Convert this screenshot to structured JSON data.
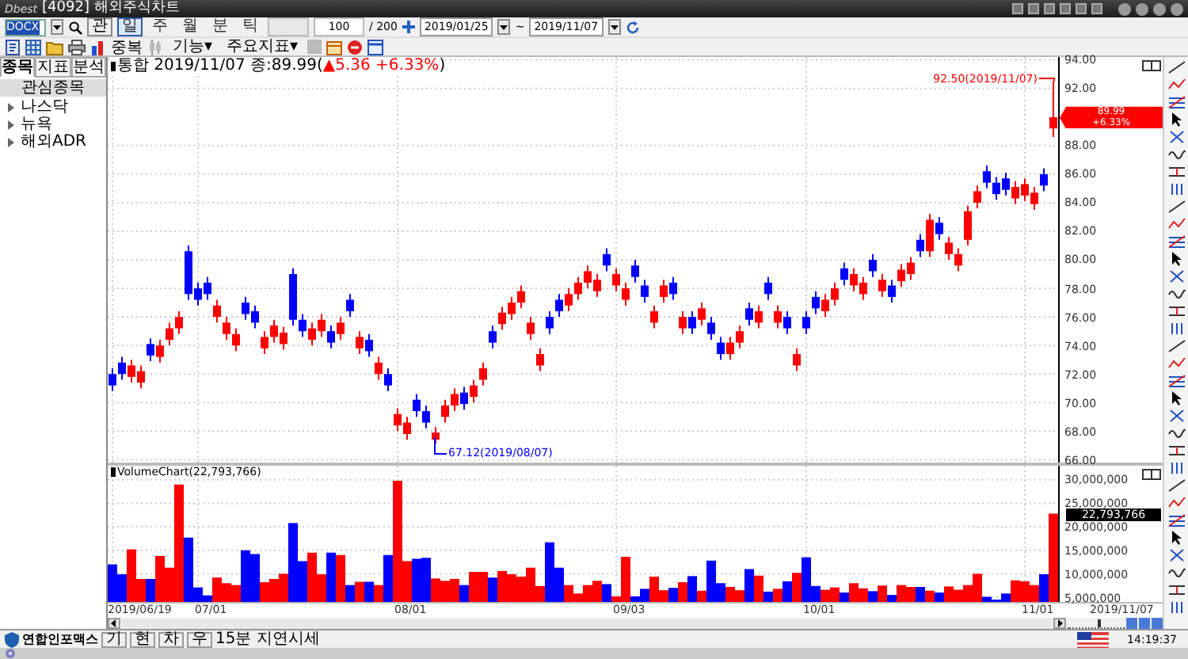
{
  "window": {
    "logo": "Dbest",
    "title": "[4092] 해외주식차트"
  },
  "toolbar": {
    "symbol": "DOCX",
    "lookup_label": "관",
    "periods": [
      {
        "label": "일",
        "selected": true
      },
      {
        "label": "주",
        "selected": false
      },
      {
        "label": "월",
        "selected": false
      },
      {
        "label": "분",
        "selected": false
      },
      {
        "label": "틱",
        "selected": false
      }
    ],
    "count": "100",
    "total": "/ 200",
    "start_date": "2019/01/25",
    "separator": "~",
    "end_date": "2019/11/07"
  },
  "toolbar2": {
    "overlap_label": "중복",
    "menus": [
      "기능▾",
      "주요지표▾"
    ]
  },
  "sidebar": {
    "tabs": [
      {
        "label": "종목",
        "selected": true
      },
      {
        "label": "지표",
        "selected": false
      },
      {
        "label": "분석",
        "selected": false
      }
    ],
    "header": "관심종목",
    "items": [
      {
        "label": "나스닥",
        "expanded": false
      },
      {
        "label": "뉴욕",
        "expanded": false
      },
      {
        "label": "해외ADR",
        "expanded": false
      }
    ]
  },
  "price_chart": {
    "info_prefix": "통합 2019/11/07 종:89.99(",
    "info_change": "▲5.36 +6.33%",
    "info_suffix": ")",
    "high_note": "92.50(2019/11/07)",
    "low_note": "67.12(2019/08/07)",
    "last_price": "89.99",
    "last_change": "+6.33%",
    "chart_data": {
      "type": "candlestick",
      "ylim": [
        65.8,
        94.2
      ],
      "yticks": [
        {
          "value": 94,
          "label": "94.00"
        },
        {
          "value": 92,
          "label": "92.00"
        },
        {
          "value": 88,
          "label": "88.00"
        },
        {
          "value": 86,
          "label": "86.00"
        },
        {
          "value": 84,
          "label": "84.00"
        },
        {
          "value": 82,
          "label": "82.00"
        },
        {
          "value": 80,
          "label": "80.00"
        },
        {
          "value": 78,
          "label": "78.00"
        },
        {
          "value": 76,
          "label": "76.00"
        },
        {
          "value": 74,
          "label": "74.00"
        },
        {
          "value": 72,
          "label": "72.00"
        },
        {
          "value": 70,
          "label": "70.00"
        },
        {
          "value": 68,
          "label": "68.00"
        },
        {
          "value": 66,
          "label": "66.00"
        }
      ],
      "grid": true,
      "ohlc": [
        [
          72.0,
          72.4,
          70.8,
          71.2
        ],
        [
          72.8,
          73.2,
          71.6,
          72.0
        ],
        [
          71.8,
          73.0,
          71.4,
          72.6
        ],
        [
          71.4,
          72.6,
          71.0,
          72.2
        ],
        [
          74.1,
          74.5,
          72.9,
          73.3
        ],
        [
          73.2,
          74.4,
          72.8,
          74.0
        ],
        [
          74.4,
          75.6,
          74.0,
          75.2
        ],
        [
          75.2,
          76.4,
          74.8,
          76.0
        ],
        [
          80.6,
          81.0,
          77.2,
          77.6
        ],
        [
          78.0,
          78.4,
          76.8,
          77.2
        ],
        [
          78.4,
          78.8,
          77.2,
          77.6
        ],
        [
          76.0,
          77.2,
          75.6,
          76.8
        ],
        [
          74.8,
          76.0,
          74.4,
          75.6
        ],
        [
          74.0,
          75.2,
          73.6,
          74.8
        ],
        [
          77.0,
          77.4,
          75.8,
          76.2
        ],
        [
          76.4,
          76.8,
          75.2,
          75.6
        ],
        [
          73.8,
          75.0,
          73.4,
          74.6
        ],
        [
          74.6,
          75.8,
          74.2,
          75.4
        ],
        [
          74.1,
          75.3,
          73.7,
          74.9
        ],
        [
          79.0,
          79.4,
          75.4,
          75.8
        ],
        [
          75.8,
          76.2,
          74.6,
          75.0
        ],
        [
          74.4,
          75.6,
          74.0,
          75.2
        ],
        [
          75.0,
          76.2,
          74.6,
          75.8
        ],
        [
          75.0,
          75.4,
          73.8,
          74.2
        ],
        [
          74.8,
          76.0,
          74.4,
          75.6
        ],
        [
          77.2,
          77.6,
          76.0,
          76.4
        ],
        [
          73.8,
          75.0,
          73.4,
          74.6
        ],
        [
          74.4,
          74.8,
          73.2,
          73.6
        ],
        [
          72.0,
          73.2,
          71.6,
          72.8
        ],
        [
          72.0,
          72.4,
          70.8,
          71.2
        ],
        [
          68.4,
          69.6,
          68.0,
          69.2
        ],
        [
          67.8,
          69.0,
          67.4,
          68.6
        ],
        [
          70.2,
          70.6,
          69.0,
          69.4
        ],
        [
          69.4,
          69.8,
          68.2,
          68.6
        ],
        [
          67.4,
          68.3,
          67.12,
          67.9
        ],
        [
          69.0,
          70.2,
          68.6,
          69.8
        ],
        [
          69.8,
          71.0,
          69.4,
          70.6
        ],
        [
          70.7,
          71.1,
          69.5,
          69.9
        ],
        [
          70.4,
          71.6,
          70.0,
          71.2
        ],
        [
          71.6,
          72.8,
          71.2,
          72.4
        ],
        [
          75.0,
          75.4,
          73.8,
          74.2
        ],
        [
          75.5,
          76.7,
          75.1,
          76.3
        ],
        [
          76.2,
          77.4,
          75.8,
          77.0
        ],
        [
          77.0,
          78.2,
          76.6,
          77.8
        ],
        [
          74.8,
          76.0,
          74.4,
          75.6
        ],
        [
          72.6,
          73.8,
          72.2,
          73.4
        ],
        [
          76.0,
          76.4,
          74.8,
          75.2
        ],
        [
          77.2,
          77.6,
          76.0,
          76.4
        ],
        [
          76.8,
          78.0,
          76.4,
          77.6
        ],
        [
          77.6,
          78.8,
          77.2,
          78.4
        ],
        [
          78.4,
          79.6,
          78.0,
          79.2
        ],
        [
          77.8,
          79.0,
          77.4,
          78.6
        ],
        [
          80.4,
          80.8,
          79.2,
          79.6
        ],
        [
          78.2,
          79.4,
          77.8,
          79.0
        ],
        [
          77.2,
          78.4,
          76.8,
          78.0
        ],
        [
          79.6,
          80.0,
          78.4,
          78.8
        ],
        [
          78.2,
          78.6,
          77.0,
          77.4
        ],
        [
          75.6,
          76.8,
          75.2,
          76.4
        ],
        [
          77.4,
          78.6,
          77.0,
          78.2
        ],
        [
          78.4,
          78.8,
          77.2,
          77.6
        ],
        [
          75.2,
          76.4,
          74.8,
          76.0
        ],
        [
          76.0,
          76.4,
          74.8,
          75.2
        ],
        [
          75.8,
          77.0,
          75.4,
          76.6
        ],
        [
          75.6,
          76.0,
          74.4,
          74.8
        ],
        [
          74.2,
          74.6,
          73.0,
          73.4
        ],
        [
          73.4,
          74.6,
          73.0,
          74.2
        ],
        [
          74.2,
          75.4,
          73.8,
          75.0
        ],
        [
          76.6,
          77.0,
          75.4,
          75.8
        ],
        [
          75.6,
          76.8,
          75.2,
          76.4
        ],
        [
          78.4,
          78.8,
          77.2,
          77.6
        ],
        [
          75.6,
          76.8,
          75.2,
          76.4
        ],
        [
          76.0,
          76.4,
          74.8,
          75.2
        ],
        [
          72.6,
          73.8,
          72.2,
          73.4
        ],
        [
          76.0,
          76.4,
          74.8,
          75.2
        ],
        [
          77.4,
          77.8,
          76.2,
          76.6
        ],
        [
          76.4,
          77.6,
          76.0,
          77.2
        ],
        [
          77.2,
          78.4,
          76.8,
          78.0
        ],
        [
          79.4,
          79.8,
          78.2,
          78.6
        ],
        [
          78.2,
          79.4,
          77.8,
          79.0
        ],
        [
          77.6,
          78.8,
          77.2,
          78.4
        ],
        [
          80.0,
          80.4,
          78.8,
          79.2
        ],
        [
          77.8,
          79.0,
          77.4,
          78.6
        ],
        [
          78.2,
          78.6,
          77.0,
          77.4
        ],
        [
          78.5,
          79.7,
          78.1,
          79.3
        ],
        [
          79.0,
          80.2,
          78.6,
          79.8
        ],
        [
          81.4,
          81.8,
          80.2,
          80.6
        ],
        [
          80.6,
          83.2,
          80.2,
          82.8
        ],
        [
          82.6,
          83.0,
          81.4,
          81.8
        ],
        [
          80.4,
          81.6,
          80.0,
          81.2
        ],
        [
          79.6,
          80.8,
          79.2,
          80.4
        ],
        [
          81.4,
          83.8,
          81.0,
          83.4
        ],
        [
          84.0,
          85.2,
          83.6,
          84.8
        ],
        [
          86.2,
          86.6,
          85.0,
          85.4
        ],
        [
          85.4,
          85.8,
          84.2,
          84.6
        ],
        [
          85.7,
          86.1,
          84.5,
          84.9
        ],
        [
          84.3,
          85.5,
          83.9,
          85.1
        ],
        [
          84.5,
          85.7,
          84.1,
          85.3
        ],
        [
          83.9,
          85.1,
          83.5,
          84.7
        ],
        [
          86.0,
          86.4,
          84.8,
          85.2
        ],
        [
          89.2,
          92.5,
          88.6,
          89.99
        ]
      ]
    }
  },
  "volume_chart": {
    "x_labels": [
      "2019/06/19",
      "07/01",
      "08/01",
      "09/03",
      "10/01",
      "11/01"
    ],
    "title_value": "(22,793,766)",
    "last_volume": "22,793,766",
    "end_date": "2019/11/07",
    "chart_data": {
      "type": "bar",
      "ylim": [
        4000000,
        33000000
      ],
      "yticks": [
        {
          "value": 30000000,
          "label": "30,000,000"
        },
        {
          "value": 25000000,
          "label": "25,000,000"
        },
        {
          "value": 20000000,
          "label": "20,000,000"
        },
        {
          "value": 15000000,
          "label": "15,000,000"
        },
        {
          "value": 10000000,
          "label": "10,000,000"
        },
        {
          "value": 5000000,
          "label": "5,000,000"
        }
      ],
      "grid": true,
      "series": [
        {
          "name": "VolumeChart",
          "values": [
            12000000,
            9900000,
            15200000,
            8900000,
            8900000,
            13800000,
            11300000,
            29000000,
            17700000,
            7100000,
            5400000,
            9200000,
            8000000,
            7600000,
            15000000,
            14200000,
            8200000,
            8900000,
            10000000,
            20800000,
            12700000,
            14500000,
            9900000,
            14500000,
            14000000,
            7600000,
            8300000,
            8300000,
            7600000,
            14000000,
            29800000,
            12700000,
            13200000,
            13400000,
            9000000,
            8500000,
            8900000,
            7600000,
            10400000,
            10400000,
            9200000,
            10600000,
            9900000,
            9400000,
            11300000,
            7400000,
            16700000,
            11300000,
            7600000,
            5800000,
            7600000,
            8500000,
            7800000,
            5200000,
            13600000,
            5200000,
            6800000,
            9400000,
            6500000,
            7000000,
            8200000,
            9500000,
            6400000,
            12800000,
            8000000,
            7200000,
            6500000,
            11000000,
            9600000,
            6200000,
            6800000,
            8400000,
            10200000,
            13500000,
            7400000,
            6600000,
            7100000,
            6000000,
            8000000,
            6900000,
            6300000,
            7500000,
            5500000,
            7600000,
            7200000,
            7200000,
            6400000,
            6000000,
            7300000,
            6600000,
            7600000,
            10000000,
            5100000,
            4500000,
            5800000,
            8600000,
            8400000,
            7600000,
            9900000,
            22800000
          ]
        }
      ]
    }
  },
  "zoom_slider": {
    "level": 0.55
  },
  "status_bar": {
    "brand": "연합인포맥스",
    "buttons": [
      "기",
      "현",
      "차",
      "우"
    ],
    "notice": "15분 지연시세",
    "time": "14:19:37"
  }
}
